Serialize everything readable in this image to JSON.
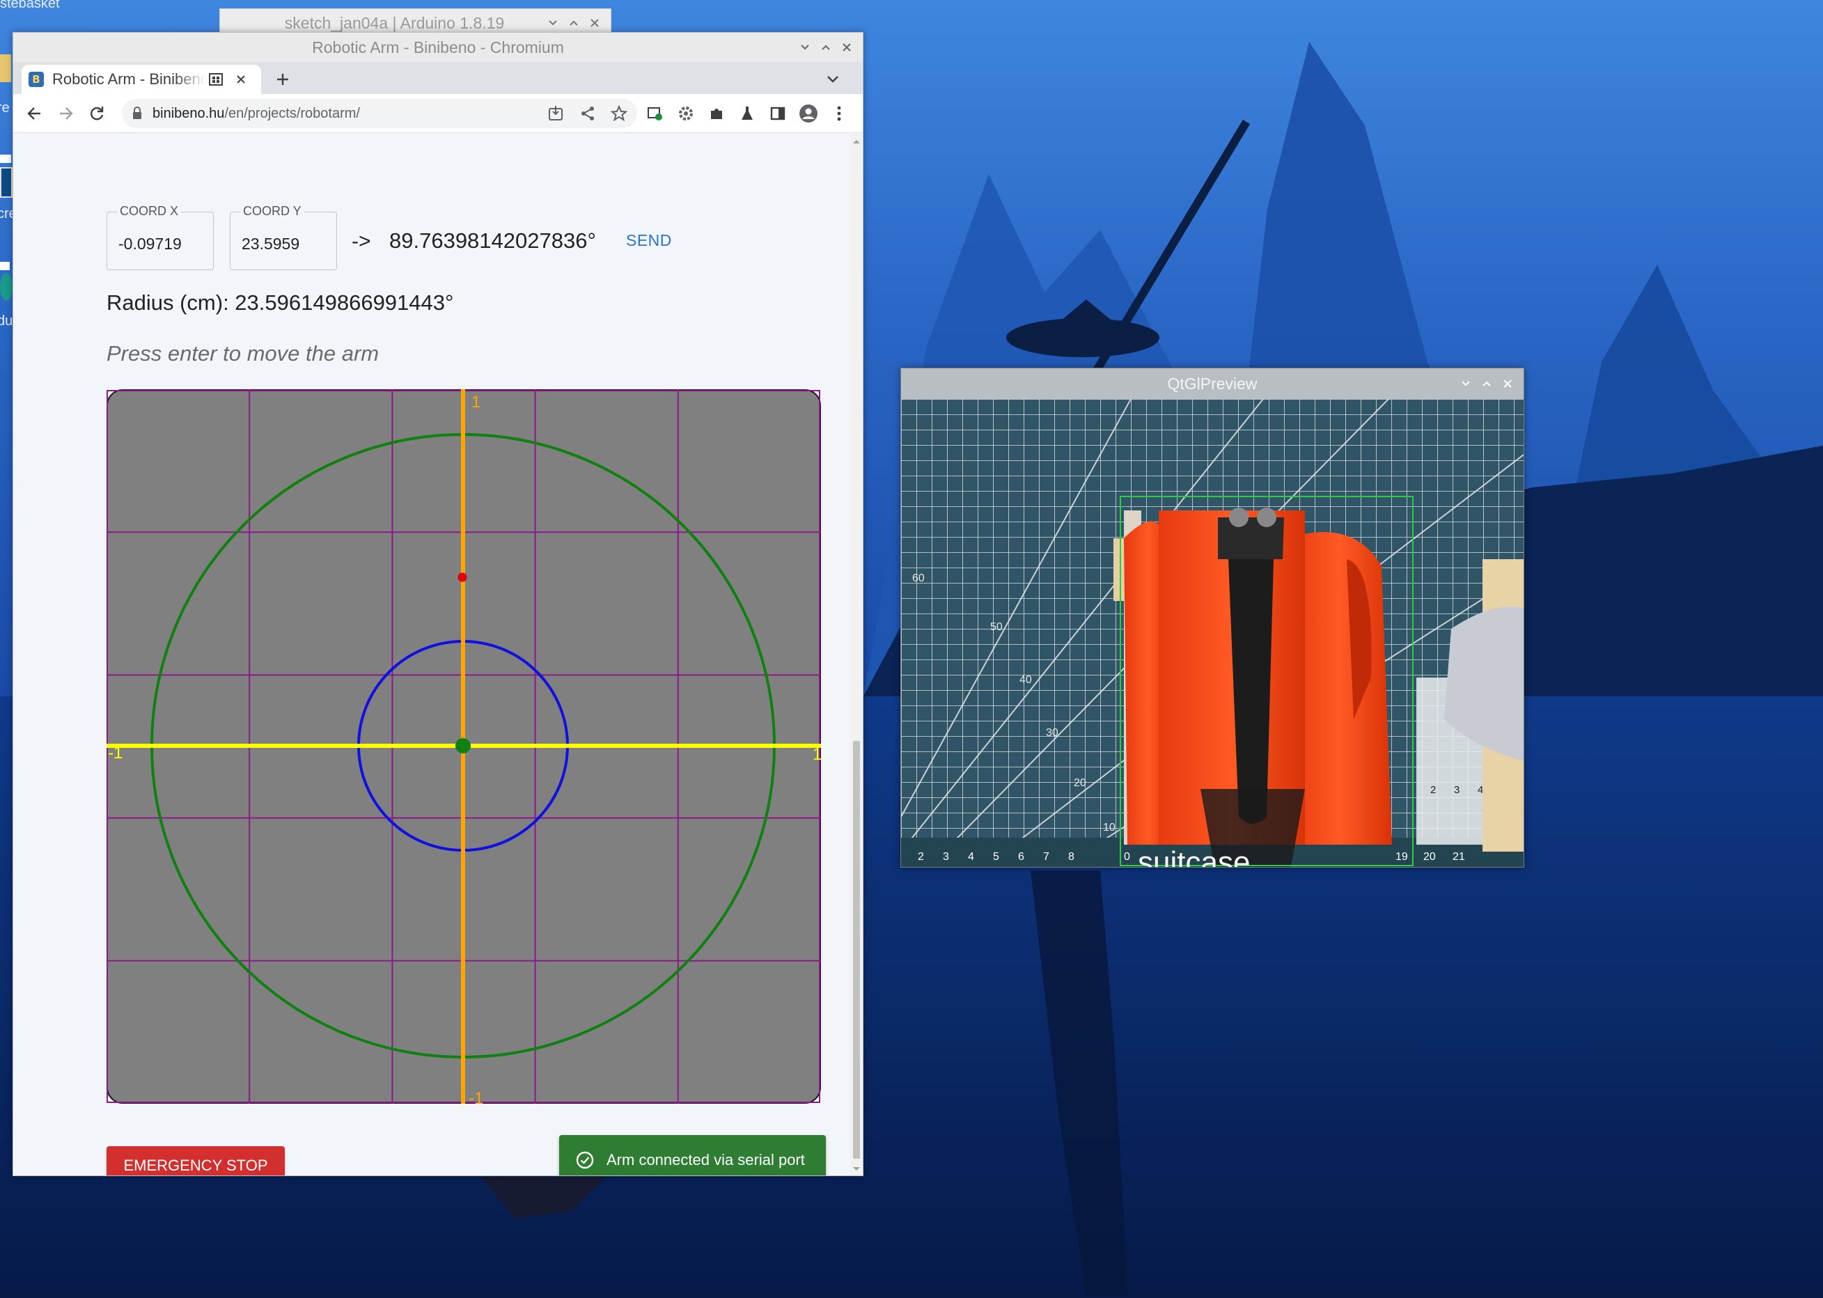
{
  "desktop": {
    "label_top": "stebasket",
    "frag_labels": [
      "re",
      "cre",
      "du"
    ]
  },
  "arduino_window": {
    "title": "sketch_jan04a | Arduino 1.8.19"
  },
  "chromium": {
    "window_title": "Robotic Arm - Binibeno - Chromium",
    "tab_title": "Robotic Arm - Binibeno",
    "favicon_letter": "B",
    "new_tab_symbol": "+",
    "url_host": "binibeno.hu",
    "url_path": "/en/projects/robotarm/"
  },
  "page": {
    "coord_x": {
      "label": "COORD X",
      "value": "-0.09719"
    },
    "coord_y": {
      "label": "COORD Y",
      "value": "23.5959"
    },
    "arrow": "->",
    "angle": "89.76398142027836°",
    "send_label": "SEND",
    "radius_text": "Radius (cm): 23.596149866991443°",
    "hint": "Press enter to move the arm",
    "emergency_label": "EMERGENCY STOP",
    "status_label": "Arm connected via serial port"
  },
  "plot": {
    "tick_top": "1",
    "tick_bottom": "-1",
    "tick_left": "-1",
    "tick_right": "1",
    "colors": {
      "background": "#808080",
      "grid": "#8a1a8a",
      "x_axis": "#ffff00",
      "y_axis": "#ffa500",
      "outer_circle": "#108010",
      "inner_circle": "#1010e0",
      "target_point": "#e00000",
      "origin_point": "#108010"
    }
  },
  "qtgl": {
    "title": "QtGlPreview",
    "ruler_numbers": [
      "2",
      "3",
      "4",
      "5",
      "6",
      "7",
      "8",
      "0",
      "19",
      "20",
      "21"
    ],
    "side_numbers": [
      "60",
      "50",
      "40",
      "30",
      "20",
      "10"
    ],
    "right_numbers": [
      "2",
      "3",
      "4"
    ],
    "caption": "suitcase"
  }
}
